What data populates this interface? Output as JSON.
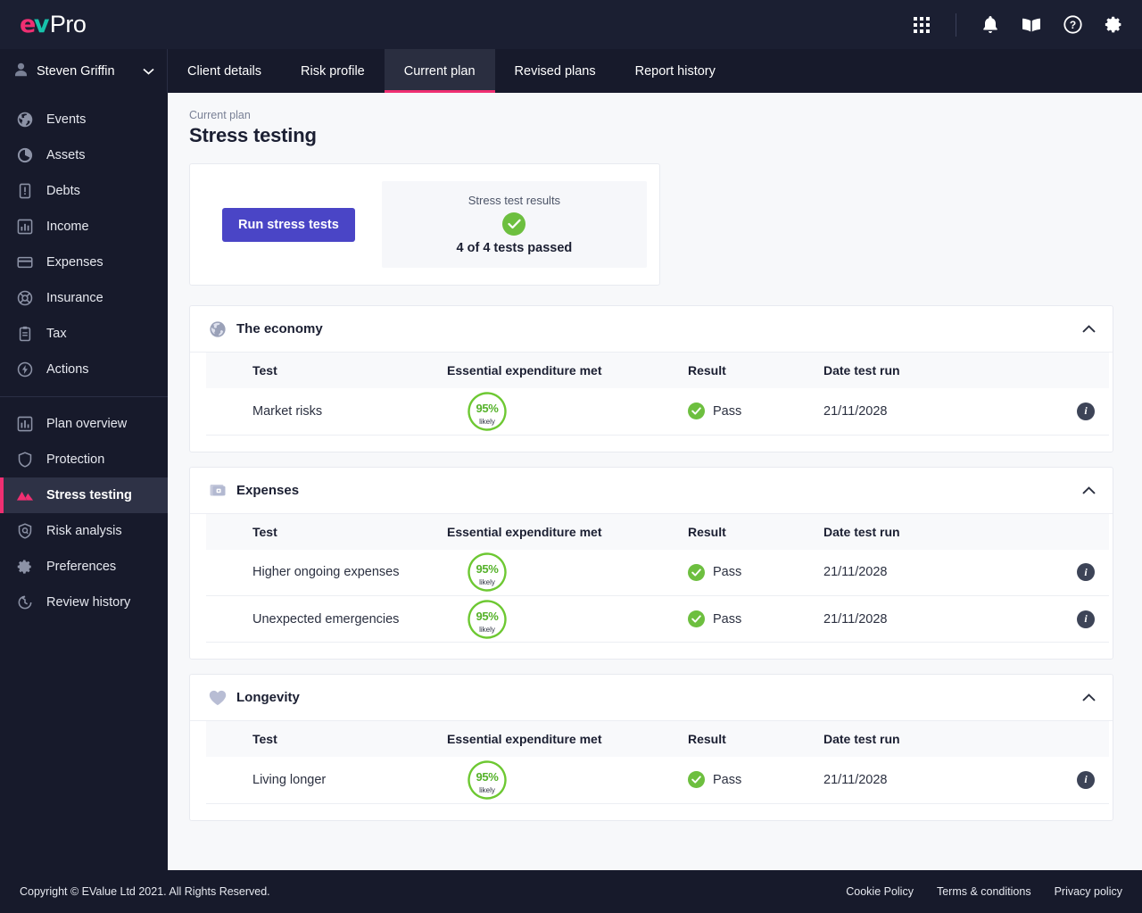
{
  "brand": {
    "mark_e": "e",
    "mark_v": "v",
    "suffix": "Pro"
  },
  "topbar": {
    "icons": [
      {
        "name": "apps-grid-icon",
        "label": "Apps"
      },
      {
        "name": "bell-icon",
        "label": "Notifications"
      },
      {
        "name": "book-icon",
        "label": "Knowledge base"
      },
      {
        "name": "help-circle-icon",
        "label": "Help"
      },
      {
        "name": "gear-icon",
        "label": "Settings"
      }
    ]
  },
  "user": {
    "name": "Steven Griffin"
  },
  "tabs": [
    {
      "label": "Client details",
      "active": false
    },
    {
      "label": "Risk profile",
      "active": false
    },
    {
      "label": "Current plan",
      "active": true
    },
    {
      "label": "Revised plans",
      "active": false
    },
    {
      "label": "Report history",
      "active": false
    }
  ],
  "sidebar": {
    "group1": [
      {
        "label": "Events",
        "icon": "globe-icon"
      },
      {
        "label": "Assets",
        "icon": "pie-chart-icon"
      },
      {
        "label": "Debts",
        "icon": "document-alert-icon"
      },
      {
        "label": "Income",
        "icon": "bar-chart-icon"
      },
      {
        "label": "Expenses",
        "icon": "card-icon"
      },
      {
        "label": "Insurance",
        "icon": "lifebuoy-icon"
      },
      {
        "label": "Tax",
        "icon": "clipboard-icon"
      },
      {
        "label": "Actions",
        "icon": "lightning-icon"
      }
    ],
    "group2": [
      {
        "label": "Plan overview",
        "icon": "chart-icon",
        "active": false
      },
      {
        "label": "Protection",
        "icon": "shield-icon",
        "active": false
      },
      {
        "label": "Stress testing",
        "icon": "mountain-icon",
        "active": true
      },
      {
        "label": "Risk analysis",
        "icon": "shield-target-icon",
        "active": false
      },
      {
        "label": "Preferences",
        "icon": "gear-icon",
        "active": false
      },
      {
        "label": "Review history",
        "icon": "history-clock-icon",
        "active": false
      }
    ]
  },
  "page": {
    "breadcrumb": "Current plan",
    "title": "Stress testing"
  },
  "summary": {
    "run_button": "Run stress tests",
    "results_label": "Stress test results",
    "results_count": "4 of 4 tests passed",
    "status_icon": "check-circle-icon"
  },
  "table_headers": {
    "test": "Test",
    "expenditure": "Essential expenditure met",
    "result": "Result",
    "date": "Date test run"
  },
  "sections": [
    {
      "title": "The economy",
      "icon": "globe-icon",
      "collapse_icon": "chevron-up-icon",
      "rows": [
        {
          "test": "Market risks",
          "gauge_value": "95%",
          "gauge_caption": "likely",
          "gauge_percent": 95,
          "result": "Pass",
          "date": "21/11/2028"
        }
      ]
    },
    {
      "title": "Expenses",
      "icon": "card-icon",
      "collapse_icon": "chevron-up-icon",
      "rows": [
        {
          "test": "Higher ongoing expenses",
          "gauge_value": "95%",
          "gauge_caption": "likely",
          "gauge_percent": 95,
          "result": "Pass",
          "date": "21/11/2028"
        },
        {
          "test": "Unexpected emergencies",
          "gauge_value": "95%",
          "gauge_caption": "likely",
          "gauge_percent": 95,
          "result": "Pass",
          "date": "21/11/2028"
        }
      ]
    },
    {
      "title": "Longevity",
      "icon": "heart-icon",
      "collapse_icon": "chevron-up-icon",
      "rows": [
        {
          "test": "Living longer",
          "gauge_value": "95%",
          "gauge_caption": "likely",
          "gauge_percent": 95,
          "result": "Pass",
          "date": "21/11/2028"
        }
      ]
    }
  ],
  "footer": {
    "copyright": "Copyright © EValue Ltd 2021. All Rights Reserved.",
    "links": [
      "Cookie Policy",
      "Terms & conditions",
      "Privacy policy"
    ]
  },
  "colors": {
    "brand_pink": "#ef2f72",
    "brand_teal": "#17c2ab",
    "primary_button": "#4a45c6",
    "success_green": "#6dbf3f",
    "gauge_green": "#55b22a",
    "dark_nav": "#171a2b"
  }
}
